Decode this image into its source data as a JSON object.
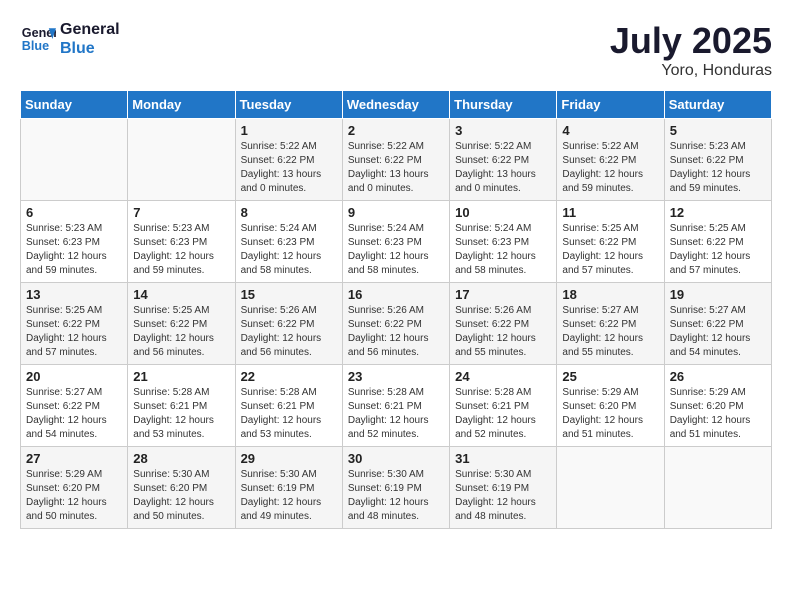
{
  "header": {
    "logo_line1": "General",
    "logo_line2": "Blue",
    "month": "July 2025",
    "location": "Yoro, Honduras"
  },
  "days_of_week": [
    "Sunday",
    "Monday",
    "Tuesday",
    "Wednesday",
    "Thursday",
    "Friday",
    "Saturday"
  ],
  "weeks": [
    [
      {
        "day": "",
        "info": ""
      },
      {
        "day": "",
        "info": ""
      },
      {
        "day": "1",
        "sunrise": "5:22 AM",
        "sunset": "6:22 PM",
        "daylight": "13 hours and 0 minutes."
      },
      {
        "day": "2",
        "sunrise": "5:22 AM",
        "sunset": "6:22 PM",
        "daylight": "13 hours and 0 minutes."
      },
      {
        "day": "3",
        "sunrise": "5:22 AM",
        "sunset": "6:22 PM",
        "daylight": "13 hours and 0 minutes."
      },
      {
        "day": "4",
        "sunrise": "5:22 AM",
        "sunset": "6:22 PM",
        "daylight": "12 hours and 59 minutes."
      },
      {
        "day": "5",
        "sunrise": "5:23 AM",
        "sunset": "6:22 PM",
        "daylight": "12 hours and 59 minutes."
      }
    ],
    [
      {
        "day": "6",
        "sunrise": "5:23 AM",
        "sunset": "6:23 PM",
        "daylight": "12 hours and 59 minutes."
      },
      {
        "day": "7",
        "sunrise": "5:23 AM",
        "sunset": "6:23 PM",
        "daylight": "12 hours and 59 minutes."
      },
      {
        "day": "8",
        "sunrise": "5:24 AM",
        "sunset": "6:23 PM",
        "daylight": "12 hours and 58 minutes."
      },
      {
        "day": "9",
        "sunrise": "5:24 AM",
        "sunset": "6:23 PM",
        "daylight": "12 hours and 58 minutes."
      },
      {
        "day": "10",
        "sunrise": "5:24 AM",
        "sunset": "6:23 PM",
        "daylight": "12 hours and 58 minutes."
      },
      {
        "day": "11",
        "sunrise": "5:25 AM",
        "sunset": "6:22 PM",
        "daylight": "12 hours and 57 minutes."
      },
      {
        "day": "12",
        "sunrise": "5:25 AM",
        "sunset": "6:22 PM",
        "daylight": "12 hours and 57 minutes."
      }
    ],
    [
      {
        "day": "13",
        "sunrise": "5:25 AM",
        "sunset": "6:22 PM",
        "daylight": "12 hours and 57 minutes."
      },
      {
        "day": "14",
        "sunrise": "5:25 AM",
        "sunset": "6:22 PM",
        "daylight": "12 hours and 56 minutes."
      },
      {
        "day": "15",
        "sunrise": "5:26 AM",
        "sunset": "6:22 PM",
        "daylight": "12 hours and 56 minutes."
      },
      {
        "day": "16",
        "sunrise": "5:26 AM",
        "sunset": "6:22 PM",
        "daylight": "12 hours and 56 minutes."
      },
      {
        "day": "17",
        "sunrise": "5:26 AM",
        "sunset": "6:22 PM",
        "daylight": "12 hours and 55 minutes."
      },
      {
        "day": "18",
        "sunrise": "5:27 AM",
        "sunset": "6:22 PM",
        "daylight": "12 hours and 55 minutes."
      },
      {
        "day": "19",
        "sunrise": "5:27 AM",
        "sunset": "6:22 PM",
        "daylight": "12 hours and 54 minutes."
      }
    ],
    [
      {
        "day": "20",
        "sunrise": "5:27 AM",
        "sunset": "6:22 PM",
        "daylight": "12 hours and 54 minutes."
      },
      {
        "day": "21",
        "sunrise": "5:28 AM",
        "sunset": "6:21 PM",
        "daylight": "12 hours and 53 minutes."
      },
      {
        "day": "22",
        "sunrise": "5:28 AM",
        "sunset": "6:21 PM",
        "daylight": "12 hours and 53 minutes."
      },
      {
        "day": "23",
        "sunrise": "5:28 AM",
        "sunset": "6:21 PM",
        "daylight": "12 hours and 52 minutes."
      },
      {
        "day": "24",
        "sunrise": "5:28 AM",
        "sunset": "6:21 PM",
        "daylight": "12 hours and 52 minutes."
      },
      {
        "day": "25",
        "sunrise": "5:29 AM",
        "sunset": "6:20 PM",
        "daylight": "12 hours and 51 minutes."
      },
      {
        "day": "26",
        "sunrise": "5:29 AM",
        "sunset": "6:20 PM",
        "daylight": "12 hours and 51 minutes."
      }
    ],
    [
      {
        "day": "27",
        "sunrise": "5:29 AM",
        "sunset": "6:20 PM",
        "daylight": "12 hours and 50 minutes."
      },
      {
        "day": "28",
        "sunrise": "5:30 AM",
        "sunset": "6:20 PM",
        "daylight": "12 hours and 50 minutes."
      },
      {
        "day": "29",
        "sunrise": "5:30 AM",
        "sunset": "6:19 PM",
        "daylight": "12 hours and 49 minutes."
      },
      {
        "day": "30",
        "sunrise": "5:30 AM",
        "sunset": "6:19 PM",
        "daylight": "12 hours and 48 minutes."
      },
      {
        "day": "31",
        "sunrise": "5:30 AM",
        "sunset": "6:19 PM",
        "daylight": "12 hours and 48 minutes."
      },
      {
        "day": "",
        "info": ""
      },
      {
        "day": "",
        "info": ""
      }
    ]
  ],
  "labels": {
    "sunrise": "Sunrise:",
    "sunset": "Sunset:",
    "daylight": "Daylight:"
  }
}
